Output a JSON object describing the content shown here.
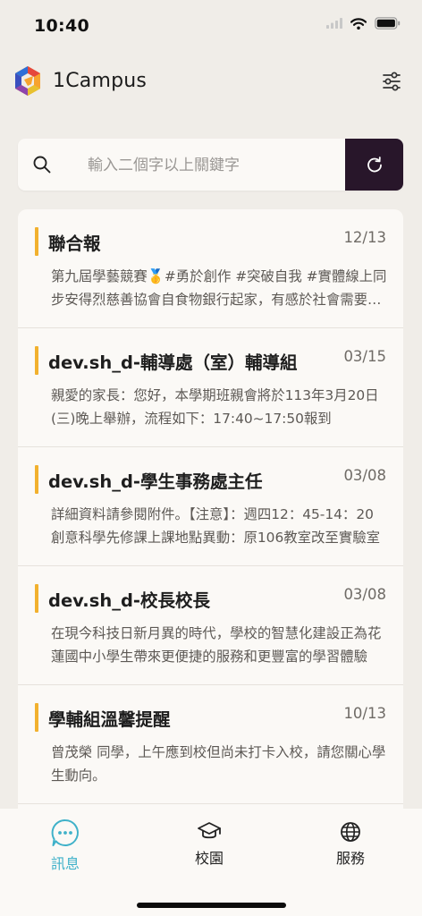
{
  "status_bar": {
    "time": "10:40"
  },
  "header": {
    "app_title": "1Campus"
  },
  "search": {
    "placeholder": "輸入二個字以上關鍵字",
    "value": ""
  },
  "messages": [
    {
      "sender": "聯合報",
      "date": "12/13",
      "preview": "第九屆學藝競賽🥇#勇於創作 #突破自我 #實體線上同步安得烈慈善協會自食物銀行起家，有感於社會需要更多的關懷"
    },
    {
      "sender": "dev.sh_d-輔導處（室）輔導組",
      "date": "03/15",
      "preview": "親愛的家長：您好，本學期班親會將於113年3月20日(三)晚上舉辦，流程如下：17:40~17:50報到"
    },
    {
      "sender": "dev.sh_d-學生事務處主任",
      "date": "03/08",
      "preview": "詳細資料請參閱附件。【注意】：週四12：45-14：20創意科學先修課上課地點異動：原106教室改至實驗室"
    },
    {
      "sender": "dev.sh_d-校長校長",
      "date": "03/08",
      "preview": "在現今科技日新月異的時代，學校的智慧化建設正為花蓮國中小學生帶來更便捷的服務和更豐富的學習體驗"
    },
    {
      "sender": "學輔組溫馨提醒",
      "date": "10/13",
      "preview": "曾茂榮 同學，上午應到校但尚未打卡入校，請您關心學生動向。"
    }
  ],
  "tabs": [
    {
      "label": "訊息",
      "icon": "chat-bubble-icon",
      "active": true
    },
    {
      "label": "校園",
      "icon": "graduation-cap-icon",
      "active": false
    },
    {
      "label": "服務",
      "icon": "globe-icon",
      "active": false
    }
  ],
  "colors": {
    "accent": "#f2b12e",
    "active_tab": "#3fb1c9",
    "refresh_button": "#28162a",
    "background": "#f0ede8"
  }
}
